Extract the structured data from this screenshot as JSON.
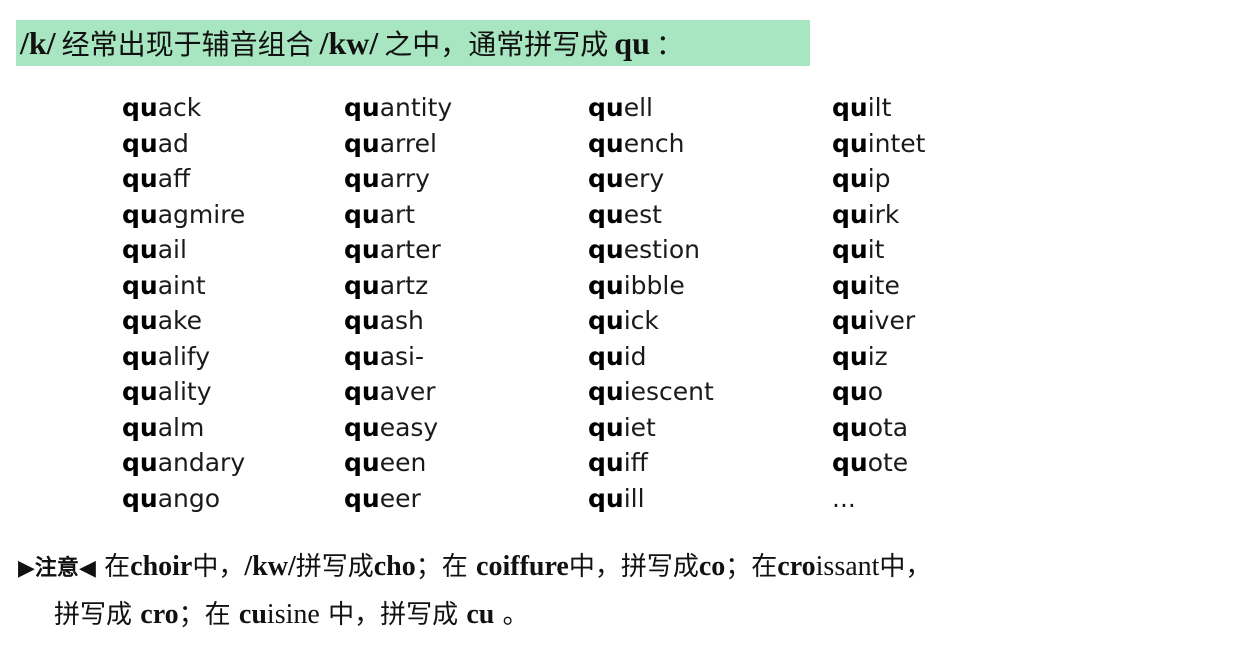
{
  "heading": {
    "seg1": "/k/",
    "seg2": "经常出现于辅音组合",
    "seg3": "/kw/",
    "seg4": "之中，通常拼写成",
    "seg5": "qu",
    "seg6": "："
  },
  "colors": {
    "heading_highlight": "#a8e6c1",
    "text": "#111111"
  },
  "words": [
    [
      {
        "pre": "qu",
        "rest": "ack"
      },
      {
        "pre": "qu",
        "rest": "ad"
      },
      {
        "pre": "qu",
        "rest": "aff"
      },
      {
        "pre": "qu",
        "rest": "agmire"
      },
      {
        "pre": "qu",
        "rest": "ail"
      },
      {
        "pre": "qu",
        "rest": "aint"
      },
      {
        "pre": "qu",
        "rest": "ake"
      },
      {
        "pre": "qu",
        "rest": "alify"
      },
      {
        "pre": "qu",
        "rest": "ality"
      },
      {
        "pre": "qu",
        "rest": "alm"
      },
      {
        "pre": "qu",
        "rest": "andary"
      },
      {
        "pre": "qu",
        "rest": "ango"
      }
    ],
    [
      {
        "pre": "qu",
        "rest": "antity"
      },
      {
        "pre": "qu",
        "rest": "arrel"
      },
      {
        "pre": "qu",
        "rest": "arry"
      },
      {
        "pre": "qu",
        "rest": "art"
      },
      {
        "pre": "qu",
        "rest": "arter"
      },
      {
        "pre": "qu",
        "rest": "artz"
      },
      {
        "pre": "qu",
        "rest": "ash"
      },
      {
        "pre": "qu",
        "rest": "asi-"
      },
      {
        "pre": "qu",
        "rest": "aver"
      },
      {
        "pre": "qu",
        "rest": "easy"
      },
      {
        "pre": "qu",
        "rest": "een"
      },
      {
        "pre": "qu",
        "rest": "eer"
      }
    ],
    [
      {
        "pre": "qu",
        "rest": "ell"
      },
      {
        "pre": "qu",
        "rest": "ench"
      },
      {
        "pre": "qu",
        "rest": "ery"
      },
      {
        "pre": "qu",
        "rest": "est"
      },
      {
        "pre": "qu",
        "rest": "estion"
      },
      {
        "pre": "qu",
        "rest": "ibble"
      },
      {
        "pre": "qu",
        "rest": "ick"
      },
      {
        "pre": "qu",
        "rest": "id"
      },
      {
        "pre": "qu",
        "rest": "iescent"
      },
      {
        "pre": "qu",
        "rest": "iet"
      },
      {
        "pre": "qu",
        "rest": "iff"
      },
      {
        "pre": "qu",
        "rest": "ill"
      }
    ],
    [
      {
        "pre": "qu",
        "rest": "ilt"
      },
      {
        "pre": "qu",
        "rest": "intet"
      },
      {
        "pre": "qu",
        "rest": "ip"
      },
      {
        "pre": "qu",
        "rest": "irk"
      },
      {
        "pre": "qu",
        "rest": "it"
      },
      {
        "pre": "qu",
        "rest": "ite"
      },
      {
        "pre": "qu",
        "rest": "iver"
      },
      {
        "pre": "qu",
        "rest": "iz"
      },
      {
        "pre": "qu",
        "rest": "o"
      },
      {
        "pre": "qu",
        "rest": "ota"
      },
      {
        "pre": "qu",
        "rest": "ote"
      },
      {
        "pre": "",
        "rest": "..."
      }
    ]
  ],
  "note": {
    "marker_left": "▶",
    "label": "注意",
    "marker_right": "◀",
    "l1_1": "在",
    "l1_2": "choir",
    "l1_3": "中，",
    "l1_4": "/kw/",
    "l1_5": "拼写成",
    "l1_6": "cho",
    "l1_7": "；在",
    "l1_8": "coiffure",
    "l1_9": "中，拼写成",
    "l1_10": "co",
    "l1_11": "；在",
    "l1_12a": "cro",
    "l1_12b": "issant",
    "l1_13": "中，",
    "l2_1": "拼写成",
    "l2_2": "cro",
    "l2_3": "；在",
    "l2_4a": "cu",
    "l2_4b": "isine",
    "l2_5": "中，拼写成",
    "l2_6": "cu",
    "l2_7": "。"
  }
}
